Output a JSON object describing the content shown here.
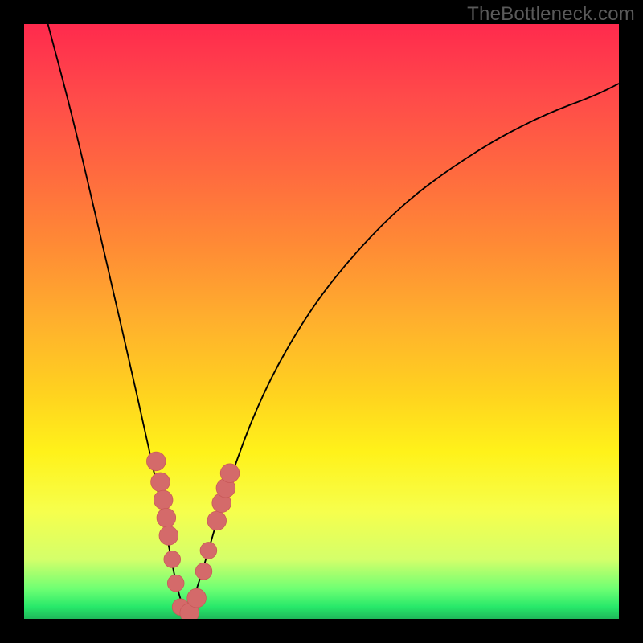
{
  "watermark": "TheBottleneck.com",
  "colors": {
    "frame": "#000000",
    "curve": "#000000",
    "marker_fill": "#d46a6a",
    "marker_stroke": "#c85858"
  },
  "chart_data": {
    "type": "line",
    "title": "",
    "xlabel": "",
    "ylabel": "",
    "xlim": [
      0,
      100
    ],
    "ylim": [
      0,
      100
    ],
    "grid": false,
    "series": [
      {
        "name": "bottleneck-curve",
        "x": [
          4,
          8,
          12,
          15,
          18,
          20,
          22,
          24,
          25.5,
          27,
          28,
          30,
          34,
          40,
          48,
          56,
          64,
          72,
          80,
          88,
          96,
          100
        ],
        "y": [
          100,
          85,
          68,
          55,
          42,
          33,
          24,
          14,
          6,
          1,
          2,
          8,
          22,
          38,
          52,
          62,
          70,
          76,
          81,
          85,
          88,
          90
        ]
      }
    ],
    "markers": [
      {
        "x": 22.2,
        "y": 26.5,
        "r": 1.6
      },
      {
        "x": 22.9,
        "y": 23.0,
        "r": 1.6
      },
      {
        "x": 23.4,
        "y": 20.0,
        "r": 1.6
      },
      {
        "x": 23.9,
        "y": 17.0,
        "r": 1.6
      },
      {
        "x": 24.3,
        "y": 14.0,
        "r": 1.6
      },
      {
        "x": 24.9,
        "y": 10.0,
        "r": 1.4
      },
      {
        "x": 25.5,
        "y": 6.0,
        "r": 1.4
      },
      {
        "x": 26.3,
        "y": 2.0,
        "r": 1.4
      },
      {
        "x": 27.8,
        "y": 1.0,
        "r": 1.6
      },
      {
        "x": 29.0,
        "y": 3.5,
        "r": 1.6
      },
      {
        "x": 30.2,
        "y": 8.0,
        "r": 1.4
      },
      {
        "x": 31.0,
        "y": 11.5,
        "r": 1.4
      },
      {
        "x": 32.4,
        "y": 16.5,
        "r": 1.6
      },
      {
        "x": 33.2,
        "y": 19.5,
        "r": 1.6
      },
      {
        "x": 33.9,
        "y": 22.0,
        "r": 1.6
      },
      {
        "x": 34.6,
        "y": 24.5,
        "r": 1.6
      }
    ]
  }
}
